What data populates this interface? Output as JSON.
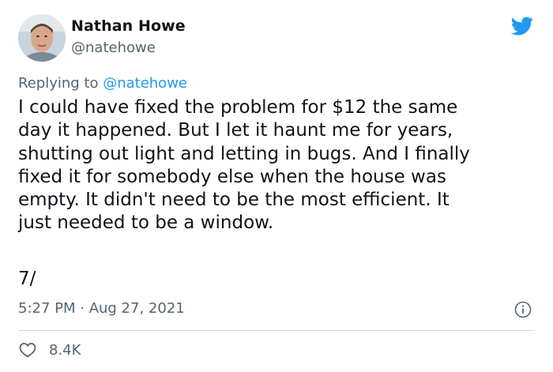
{
  "author": {
    "name": "Nathan Howe",
    "handle": "@natehowe"
  },
  "reply": {
    "prefix": "Replying to ",
    "mention": "@natehowe"
  },
  "tweet": {
    "lines": [
      "I could have fixed the problem for $12 the same",
      "day it happened. But I let it haunt me for years,",
      "shutting out light and letting in bugs. And I finally",
      "fixed it for somebody else when the house was",
      "empty. It didn't need to be the most efficient. It",
      "just needed to be a window."
    ],
    "thread_number": "7/",
    "timestamp": "5:27 PM · Aug 27, 2021"
  },
  "engagement": {
    "likes": "8.4K"
  },
  "colors": {
    "accent": "#1d9bf0",
    "text": "#0f1419",
    "muted": "#536471",
    "divider": "#cfd9de"
  },
  "icons": {
    "brand": "twitter-bird-icon",
    "info": "info-icon",
    "like": "heart-icon"
  }
}
